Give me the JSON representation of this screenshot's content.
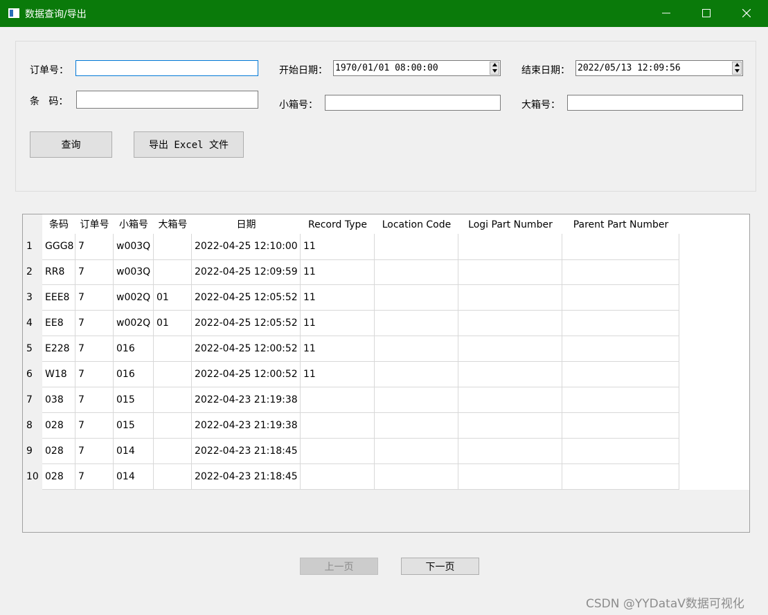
{
  "window": {
    "title": "数据查询/导出",
    "titlebar_color": "#0a7a0a"
  },
  "filters": {
    "order_label": "订单号：",
    "order_value": "",
    "barcode_label": "条   码：",
    "barcode_value": "",
    "start_label": "开始日期：",
    "start_value": "1970/01/01 08:00:00",
    "end_label": "结束日期：",
    "end_value": "2022/05/13 12:09:56",
    "small_box_label": "小箱号：",
    "small_box_value": "",
    "big_box_label": "大箱号：",
    "big_box_value": ""
  },
  "actions": {
    "query_label": "查询",
    "export_label": "导出 Excel 文件"
  },
  "table": {
    "columns": [
      "条码",
      "订单号",
      "小箱号",
      "大箱号",
      "日期",
      "Record Type",
      "Location Code",
      "Logi Part Number",
      "Parent Part Number"
    ],
    "row_numbers": [
      "1",
      "2",
      "3",
      "4",
      "5",
      "6",
      "7",
      "8",
      "9",
      "10"
    ],
    "rows": [
      [
        "GGG8",
        "7",
        "w003Q",
        "",
        "2022-04-25 12:10:00",
        "11",
        "",
        "",
        ""
      ],
      [
        "RR8",
        "7",
        "w003Q",
        "",
        "2022-04-25 12:09:59",
        "11",
        "",
        "",
        ""
      ],
      [
        "EEE8",
        "7",
        "w002Q",
        "01",
        "2022-04-25 12:05:52",
        "11",
        "",
        "",
        ""
      ],
      [
        "EE8",
        "7",
        "w002Q",
        "01",
        "2022-04-25 12:05:52",
        "11",
        "",
        "",
        ""
      ],
      [
        "E228",
        "7",
        "016",
        "",
        "2022-04-25 12:00:52",
        "11",
        "",
        "",
        ""
      ],
      [
        "W18",
        "7",
        "016",
        "",
        "2022-04-25 12:00:52",
        "11",
        "",
        "",
        ""
      ],
      [
        "038",
        "7",
        "015",
        "",
        "2022-04-23 21:19:38",
        "",
        "",
        "",
        ""
      ],
      [
        "028",
        "7",
        "015",
        "",
        "2022-04-23 21:19:38",
        "",
        "",
        "",
        ""
      ],
      [
        "028",
        "7",
        "014",
        "",
        "2022-04-23 21:18:45",
        "",
        "",
        "",
        ""
      ],
      [
        "028",
        "7",
        "014",
        "",
        "2022-04-23 21:18:45",
        "",
        "",
        "",
        ""
      ]
    ]
  },
  "pager": {
    "prev_label": "上一页",
    "next_label": "下一页"
  },
  "watermark": "CSDN @YYDataV数据可视化"
}
